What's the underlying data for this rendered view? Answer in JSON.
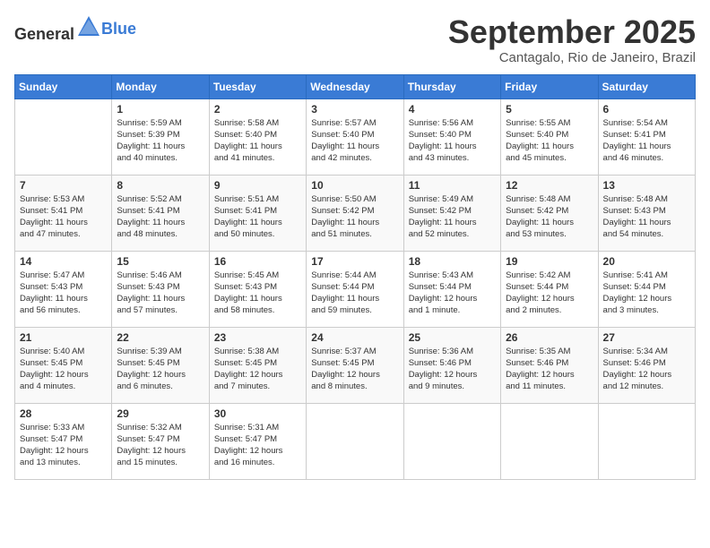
{
  "header": {
    "logo_general": "General",
    "logo_blue": "Blue",
    "month_title": "September 2025",
    "location": "Cantagalo, Rio de Janeiro, Brazil"
  },
  "days_of_week": [
    "Sunday",
    "Monday",
    "Tuesday",
    "Wednesday",
    "Thursday",
    "Friday",
    "Saturday"
  ],
  "weeks": [
    [
      {
        "day": "",
        "info": ""
      },
      {
        "day": "1",
        "info": "Sunrise: 5:59 AM\nSunset: 5:39 PM\nDaylight: 11 hours\nand 40 minutes."
      },
      {
        "day": "2",
        "info": "Sunrise: 5:58 AM\nSunset: 5:40 PM\nDaylight: 11 hours\nand 41 minutes."
      },
      {
        "day": "3",
        "info": "Sunrise: 5:57 AM\nSunset: 5:40 PM\nDaylight: 11 hours\nand 42 minutes."
      },
      {
        "day": "4",
        "info": "Sunrise: 5:56 AM\nSunset: 5:40 PM\nDaylight: 11 hours\nand 43 minutes."
      },
      {
        "day": "5",
        "info": "Sunrise: 5:55 AM\nSunset: 5:40 PM\nDaylight: 11 hours\nand 45 minutes."
      },
      {
        "day": "6",
        "info": "Sunrise: 5:54 AM\nSunset: 5:41 PM\nDaylight: 11 hours\nand 46 minutes."
      }
    ],
    [
      {
        "day": "7",
        "info": "Sunrise: 5:53 AM\nSunset: 5:41 PM\nDaylight: 11 hours\nand 47 minutes."
      },
      {
        "day": "8",
        "info": "Sunrise: 5:52 AM\nSunset: 5:41 PM\nDaylight: 11 hours\nand 48 minutes."
      },
      {
        "day": "9",
        "info": "Sunrise: 5:51 AM\nSunset: 5:41 PM\nDaylight: 11 hours\nand 50 minutes."
      },
      {
        "day": "10",
        "info": "Sunrise: 5:50 AM\nSunset: 5:42 PM\nDaylight: 11 hours\nand 51 minutes."
      },
      {
        "day": "11",
        "info": "Sunrise: 5:49 AM\nSunset: 5:42 PM\nDaylight: 11 hours\nand 52 minutes."
      },
      {
        "day": "12",
        "info": "Sunrise: 5:48 AM\nSunset: 5:42 PM\nDaylight: 11 hours\nand 53 minutes."
      },
      {
        "day": "13",
        "info": "Sunrise: 5:48 AM\nSunset: 5:43 PM\nDaylight: 11 hours\nand 54 minutes."
      }
    ],
    [
      {
        "day": "14",
        "info": "Sunrise: 5:47 AM\nSunset: 5:43 PM\nDaylight: 11 hours\nand 56 minutes."
      },
      {
        "day": "15",
        "info": "Sunrise: 5:46 AM\nSunset: 5:43 PM\nDaylight: 11 hours\nand 57 minutes."
      },
      {
        "day": "16",
        "info": "Sunrise: 5:45 AM\nSunset: 5:43 PM\nDaylight: 11 hours\nand 58 minutes."
      },
      {
        "day": "17",
        "info": "Sunrise: 5:44 AM\nSunset: 5:44 PM\nDaylight: 11 hours\nand 59 minutes."
      },
      {
        "day": "18",
        "info": "Sunrise: 5:43 AM\nSunset: 5:44 PM\nDaylight: 12 hours\nand 1 minute."
      },
      {
        "day": "19",
        "info": "Sunrise: 5:42 AM\nSunset: 5:44 PM\nDaylight: 12 hours\nand 2 minutes."
      },
      {
        "day": "20",
        "info": "Sunrise: 5:41 AM\nSunset: 5:44 PM\nDaylight: 12 hours\nand 3 minutes."
      }
    ],
    [
      {
        "day": "21",
        "info": "Sunrise: 5:40 AM\nSunset: 5:45 PM\nDaylight: 12 hours\nand 4 minutes."
      },
      {
        "day": "22",
        "info": "Sunrise: 5:39 AM\nSunset: 5:45 PM\nDaylight: 12 hours\nand 6 minutes."
      },
      {
        "day": "23",
        "info": "Sunrise: 5:38 AM\nSunset: 5:45 PM\nDaylight: 12 hours\nand 7 minutes."
      },
      {
        "day": "24",
        "info": "Sunrise: 5:37 AM\nSunset: 5:45 PM\nDaylight: 12 hours\nand 8 minutes."
      },
      {
        "day": "25",
        "info": "Sunrise: 5:36 AM\nSunset: 5:46 PM\nDaylight: 12 hours\nand 9 minutes."
      },
      {
        "day": "26",
        "info": "Sunrise: 5:35 AM\nSunset: 5:46 PM\nDaylight: 12 hours\nand 11 minutes."
      },
      {
        "day": "27",
        "info": "Sunrise: 5:34 AM\nSunset: 5:46 PM\nDaylight: 12 hours\nand 12 minutes."
      }
    ],
    [
      {
        "day": "28",
        "info": "Sunrise: 5:33 AM\nSunset: 5:47 PM\nDaylight: 12 hours\nand 13 minutes."
      },
      {
        "day": "29",
        "info": "Sunrise: 5:32 AM\nSunset: 5:47 PM\nDaylight: 12 hours\nand 15 minutes."
      },
      {
        "day": "30",
        "info": "Sunrise: 5:31 AM\nSunset: 5:47 PM\nDaylight: 12 hours\nand 16 minutes."
      },
      {
        "day": "",
        "info": ""
      },
      {
        "day": "",
        "info": ""
      },
      {
        "day": "",
        "info": ""
      },
      {
        "day": "",
        "info": ""
      }
    ]
  ]
}
